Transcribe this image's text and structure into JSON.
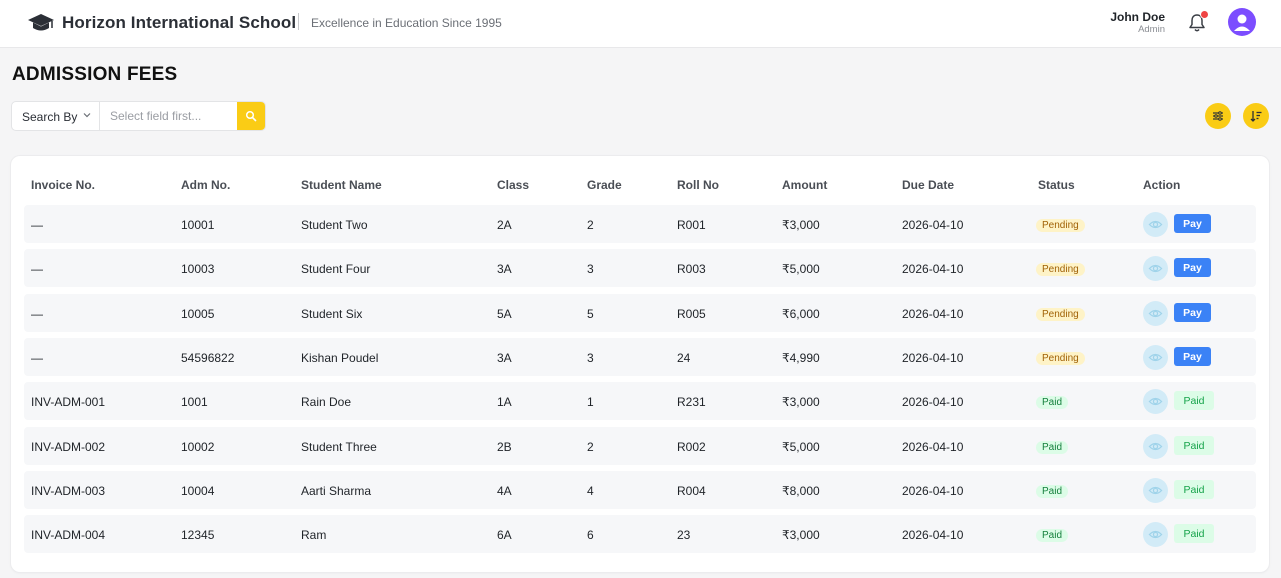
{
  "header": {
    "school_name": "Horizon International School",
    "tagline": "Excellence in Education Since 1995",
    "user_name": "John Doe",
    "user_role": "Admin",
    "notification_dot_color": "#ef4444",
    "avatar_color": "#7c4dff"
  },
  "page": {
    "title": "ADMISSION FEES"
  },
  "search": {
    "by_label": "Search By",
    "placeholder": "Select field first...",
    "value": ""
  },
  "colors": {
    "accent": "#facc15",
    "pay_button": "#3b82f6",
    "pending_badge": "#fef3c7",
    "paid_badge": "#dcfce7"
  },
  "table": {
    "columns": [
      "Invoice No.",
      "Adm No.",
      "Student Name",
      "Class",
      "Grade",
      "Roll No",
      "Amount",
      "Due Date",
      "Status",
      "Action"
    ],
    "rows": [
      {
        "invoice": "—",
        "adm": "10001",
        "name": "Student Two",
        "class": "2A",
        "grade": "2",
        "roll": "R001",
        "amount": "₹3,000",
        "due": "2026-04-10",
        "status": "Pending",
        "action": "Pay"
      },
      {
        "invoice": "—",
        "adm": "10003",
        "name": "Student Four",
        "class": "3A",
        "grade": "3",
        "roll": "R003",
        "amount": "₹5,000",
        "due": "2026-04-10",
        "status": "Pending",
        "action": "Pay"
      },
      {
        "invoice": "—",
        "adm": "10005",
        "name": "Student Six",
        "class": "5A",
        "grade": "5",
        "roll": "R005",
        "amount": "₹6,000",
        "due": "2026-04-10",
        "status": "Pending",
        "action": "Pay"
      },
      {
        "invoice": "—",
        "adm": "54596822",
        "name": "Kishan Poudel",
        "class": "3A",
        "grade": "3",
        "roll": "24",
        "amount": "₹4,990",
        "due": "2026-04-10",
        "status": "Pending",
        "action": "Pay"
      },
      {
        "invoice": "INV-ADM-001",
        "adm": "1001",
        "name": "Rain Doe",
        "class": "1A",
        "grade": "1",
        "roll": "R231",
        "amount": "₹3,000",
        "due": "2026-04-10",
        "status": "Paid",
        "action": "Paid"
      },
      {
        "invoice": "INV-ADM-002",
        "adm": "10002",
        "name": "Student Three",
        "class": "2B",
        "grade": "2",
        "roll": "R002",
        "amount": "₹5,000",
        "due": "2026-04-10",
        "status": "Paid",
        "action": "Paid"
      },
      {
        "invoice": "INV-ADM-003",
        "adm": "10004",
        "name": "Aarti Sharma",
        "class": "4A",
        "grade": "4",
        "roll": "R004",
        "amount": "₹8,000",
        "due": "2026-04-10",
        "status": "Paid",
        "action": "Paid"
      },
      {
        "invoice": "INV-ADM-004",
        "adm": "12345",
        "name": "Ram",
        "class": "6A",
        "grade": "6",
        "roll": "23",
        "amount": "₹3,000",
        "due": "2026-04-10",
        "status": "Paid",
        "action": "Paid"
      }
    ]
  }
}
